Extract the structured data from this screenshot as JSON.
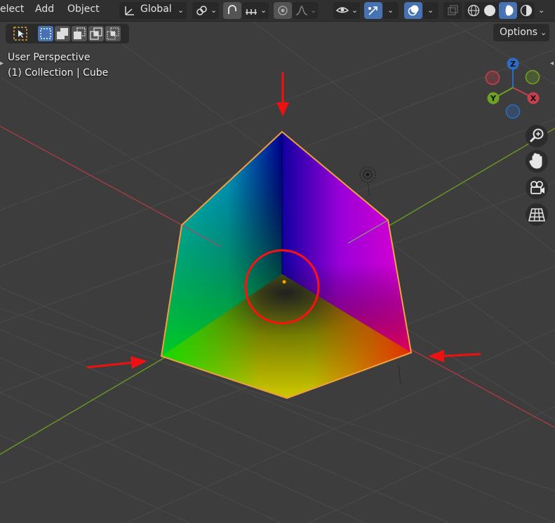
{
  "header": {
    "menu": [
      "elect",
      "Add",
      "Object"
    ],
    "transform_orientation": "Global"
  },
  "overlay": {
    "line1": "User Perspective",
    "line2": "(1) Collection | Cube"
  },
  "options_label": "Options",
  "gizmo": {
    "z": "Z",
    "y": "Y",
    "x": "X"
  },
  "colors": {
    "background": "#3d3d3d",
    "header": "#303030",
    "accent_blue": "#4772b3",
    "x_axis": "#c4404c",
    "y_axis": "#6ea024",
    "z_axis": "#2b6cc4",
    "selection_outline": "#f0a040",
    "annotation_red": "#ff0000"
  },
  "icons": [
    "select-box-icon",
    "mode-new-icon",
    "mode-extend-icon",
    "mode-subtract-icon",
    "mode-invert-icon",
    "mode-intersect-icon",
    "pivot-icon",
    "link-icon",
    "snap-icon",
    "snap-increment-icon",
    "proportional-edit-icon",
    "falloff-icon",
    "visibility-icon",
    "gizmo-icon",
    "overlay-icon",
    "xray-icon",
    "wireframe-icon",
    "solid-icon",
    "material-icon",
    "rendered-icon",
    "zoom-icon",
    "hand-icon",
    "camera-icon",
    "grid-icon",
    "light-icon"
  ]
}
